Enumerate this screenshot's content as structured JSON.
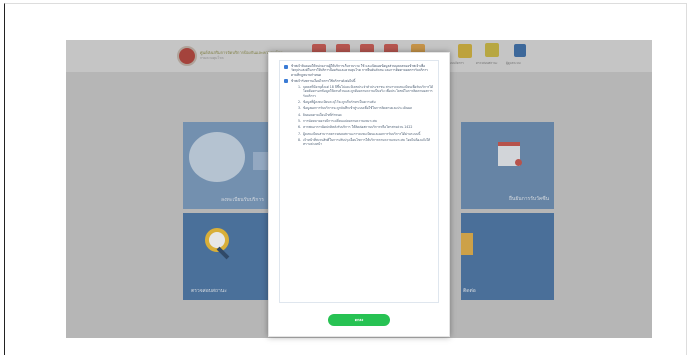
{
  "site": {
    "title_line1": "ศูนย์ส่งเสริมการจัดบริการป้องกันและควบคุมโรค",
    "title_line2": "กรมควบคุมโรค",
    "nav_items": [
      {
        "label": "",
        "icon": "scale-icon",
        "color": "#d9534f"
      },
      {
        "label": "",
        "icon": "chart-icon",
        "color": "#d9534f"
      },
      {
        "label": "",
        "icon": "doc-icon",
        "color": "#d9534f"
      },
      {
        "label": "",
        "icon": "list-icon",
        "color": "#d9534f"
      },
      {
        "label": "",
        "icon": "user-icon",
        "color": "#e9a23b"
      },
      {
        "label": "ระบบจัดการ",
        "icon": "grid-icon",
        "color": "#e9a23b"
      },
      {
        "label": "ตรวจสอบสถานะ",
        "icon": "calendar-icon",
        "color": "#e9c43b"
      },
      {
        "label": "ผู้ดูแลระบบ",
        "icon": "person-icon",
        "color": "#3a6db3"
      }
    ],
    "tiles": [
      {
        "label": "ลงทะเบียนรับบริการ",
        "icon": "baby-photo"
      },
      {
        "label": "",
        "icon": "hidden"
      },
      {
        "label": "ยืนยันการรับวัคซีน",
        "icon": "calendar-icon"
      },
      {
        "label": "ตรวจสอบสถานะ",
        "icon": "magnifier-icon"
      },
      {
        "label": "",
        "icon": "hidden"
      },
      {
        "label": "ติดต่อ",
        "icon": "folder-icon"
      }
    ]
  },
  "modal": {
    "section1": "ข้าพเจ้ายินยอมให้หน่วยงานผู้ให้บริการเก็บรวบรวม ใช้ และเปิดเผยข้อมูลส่วนบุคคลของข้าพเจ้าเพื่อวัตถุประสงค์ในการให้บริการป้องกันและควบคุมโรค การยืนยันตัวตน และการติดตามผลการรับบริการ ตามที่กฎหมายกำหนด",
    "section2": "ข้าพเจ้ารับทราบเงื่อนไขการใช้บริการดังต่อไปนี้",
    "items": [
      {
        "num": "1.",
        "text": "บุคคลที่มีอายุตั้งแต่ 18 ปีขึ้นไปและมีเลขประจำตัวประชาชน สามารถลงทะเบียนเพื่อรับบริการได้ โดยต้องกรอกข้อมูลให้ครบถ้วนและถูกต้องตามความเป็นจริง เพื่อประโยชน์ในการติดตามผลการรับบริการ"
      },
      {
        "num": "2.",
        "text": "ข้อมูลที่ผู้ลงทะเบียนระบุไว้จะถูกเก็บรักษาเป็นความลับ"
      },
      {
        "num": "3.",
        "text": "ข้อมูลผลการรับบริการจะถูกบันทึกเข้าสู่ระบบเพื่อใช้ในการติดตามและประเมินผล"
      },
      {
        "num": "4.",
        "text": "ยินยอมตามเงื่อนไขที่กำหนด"
      },
      {
        "num": "5.",
        "text": "การนัดหมายอาจมีการเปลี่ยนแปลงตามความเหมาะสม"
      },
      {
        "num": "6.",
        "text": "หากพบอาการผิดปกติหลังรับบริการ ให้ติดต่อสถานบริการหรือโทรสายด่วน 1422"
      },
      {
        "num": "7.",
        "text": "ผู้ลงทะเบียนสามารถตรวจสอบสถานะการลงทะเบียนและผลการรับบริการได้ผ่านระบบนี้"
      },
      {
        "num": "8.",
        "text": "เจ้าหน้าที่สงวนสิทธิ์ในการปรับปรุงเงื่อนไขการให้บริการตามความเหมาะสม โดยไม่ต้องแจ้งให้ทราบล่วงหน้า"
      }
    ],
    "ok_label": "ตกลง"
  }
}
